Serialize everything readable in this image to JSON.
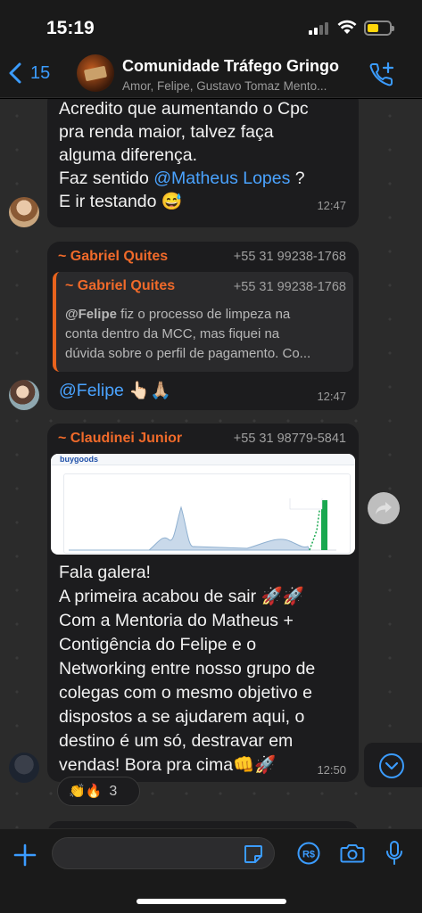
{
  "status_bar": {
    "time": "15:19"
  },
  "header": {
    "back_count": "15",
    "title": "Comunidade Tráfego Gringo",
    "subtitle": "Amor, Felipe, Gustavo Tomaz Mento..."
  },
  "messages": [
    {
      "lines": [
        "Acredito que aumentando o Cpc",
        "pra renda maior, talvez faça",
        "alguma diferença."
      ],
      "line4_prefix": "Faz sentido ",
      "line4_mention": "@Matheus Lopes",
      "line4_suffix": " ?",
      "line5": "E ir testando",
      "line5_emoji": "😅",
      "time": "12:47"
    },
    {
      "sender": "~ Gabriel Quites",
      "phone": "+55 31 99238-1768",
      "quote": {
        "sender": "~ Gabriel Quites",
        "phone": "+55 31 99238-1768",
        "mention": "@Felipe",
        "text_1": " fiz o processo de limpeza na",
        "text_2": "conta dentro da MCC, mas fiquei na",
        "text_3": "dúvida sobre o perfil de pagamento. Co..."
      },
      "mention": "@Felipe",
      "emojis": "👆🏻🙏🏼",
      "time": "12:47"
    },
    {
      "sender": "~ Claudinei Junior",
      "phone": "+55 31 98779-5841",
      "screenshot_logo": "buygoods",
      "lines": [
        "Fala galera!",
        "A primeira acabou de sair 🚀🚀",
        "Com a Mentoria do Matheus +",
        "Contigência do Felipe e o",
        "Networking entre nosso grupo de",
        "colegas com o mesmo objetivo e",
        "dispostos a se ajudarem aqui, o",
        "destino é um só, destravar em",
        "vendas! Bora pra cima👊🚀"
      ],
      "time": "12:50",
      "reactions": {
        "emojis": "👏🔥",
        "count": "3"
      }
    }
  ],
  "colors": {
    "accent": "#3b9cff",
    "sender": "#f06a2a",
    "bubble": "#1c1c1e",
    "background": "#2b2b2b"
  }
}
